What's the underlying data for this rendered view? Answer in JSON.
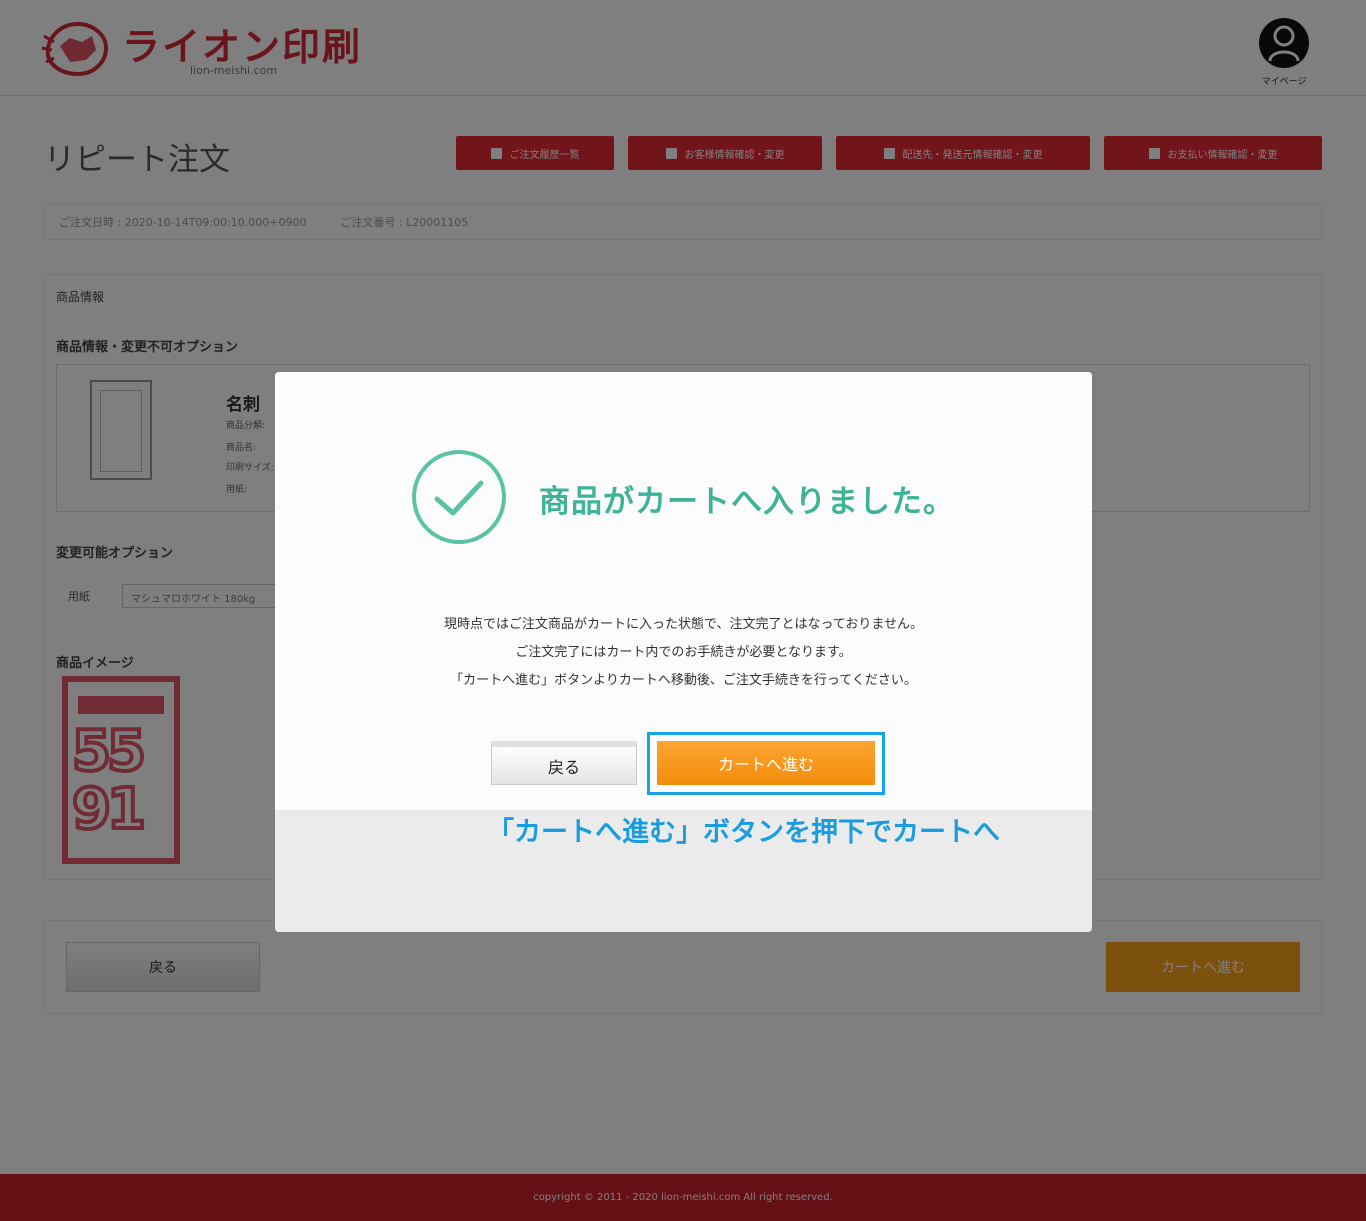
{
  "header": {
    "logo_text": "ライオン印刷",
    "logo_sub": "lion-meishi.com",
    "account_label": "マイページ"
  },
  "page": {
    "title": "リピート注文",
    "top_buttons": [
      {
        "label": "ご注文履歴一覧"
      },
      {
        "label": "お客様情報確認・変更"
      },
      {
        "label": "配送先・発送元情報確認・変更"
      },
      {
        "label": "お支払い情報確認・変更"
      }
    ],
    "info": {
      "order_date": "ご注文日時 : 2020-10-14T09:00:10.000+0900",
      "order_number": "ご注文番号 : L20001105"
    },
    "section_product": "商品情報",
    "section_product_options": "商品情報・変更不可オプション",
    "product_name": "名刺",
    "product_lines": [
      "商品分類:",
      "商品名:",
      "印刷サイズ:",
      "用紙:"
    ],
    "section_changeable": "変更可能オプション",
    "option_label": "用紙",
    "option_value": "マシュマロホワイト 180kg",
    "section_image": "商品イメージ",
    "image_digits_1": "55",
    "image_digits_2": "91",
    "back_button": "戻る",
    "cart_button": "カートへ進む",
    "footer": "copyright © 2011 - 2020 lion-meishi.com All right reserved."
  },
  "modal": {
    "title": "商品がカートへ入りました。",
    "messages": [
      "現時点ではご注文商品がカートに入った状態で、注文完了とはなっておりません。",
      "ご注文完了にはカート内でのお手続きが必要となります。",
      "「カートへ進む」ボタンよりカートへ移動後、ご注文手続きを行ってください。"
    ],
    "back_button": "戻る",
    "cart_button": "カートへ進む",
    "annotation": "「カートへ進む」ボタンを押下でカートへ"
  },
  "colors": {
    "brand_red": "#e52a35",
    "success_green": "#3fb397",
    "cart_orange": "#f7a21a",
    "highlight_blue": "#17a3e8"
  }
}
